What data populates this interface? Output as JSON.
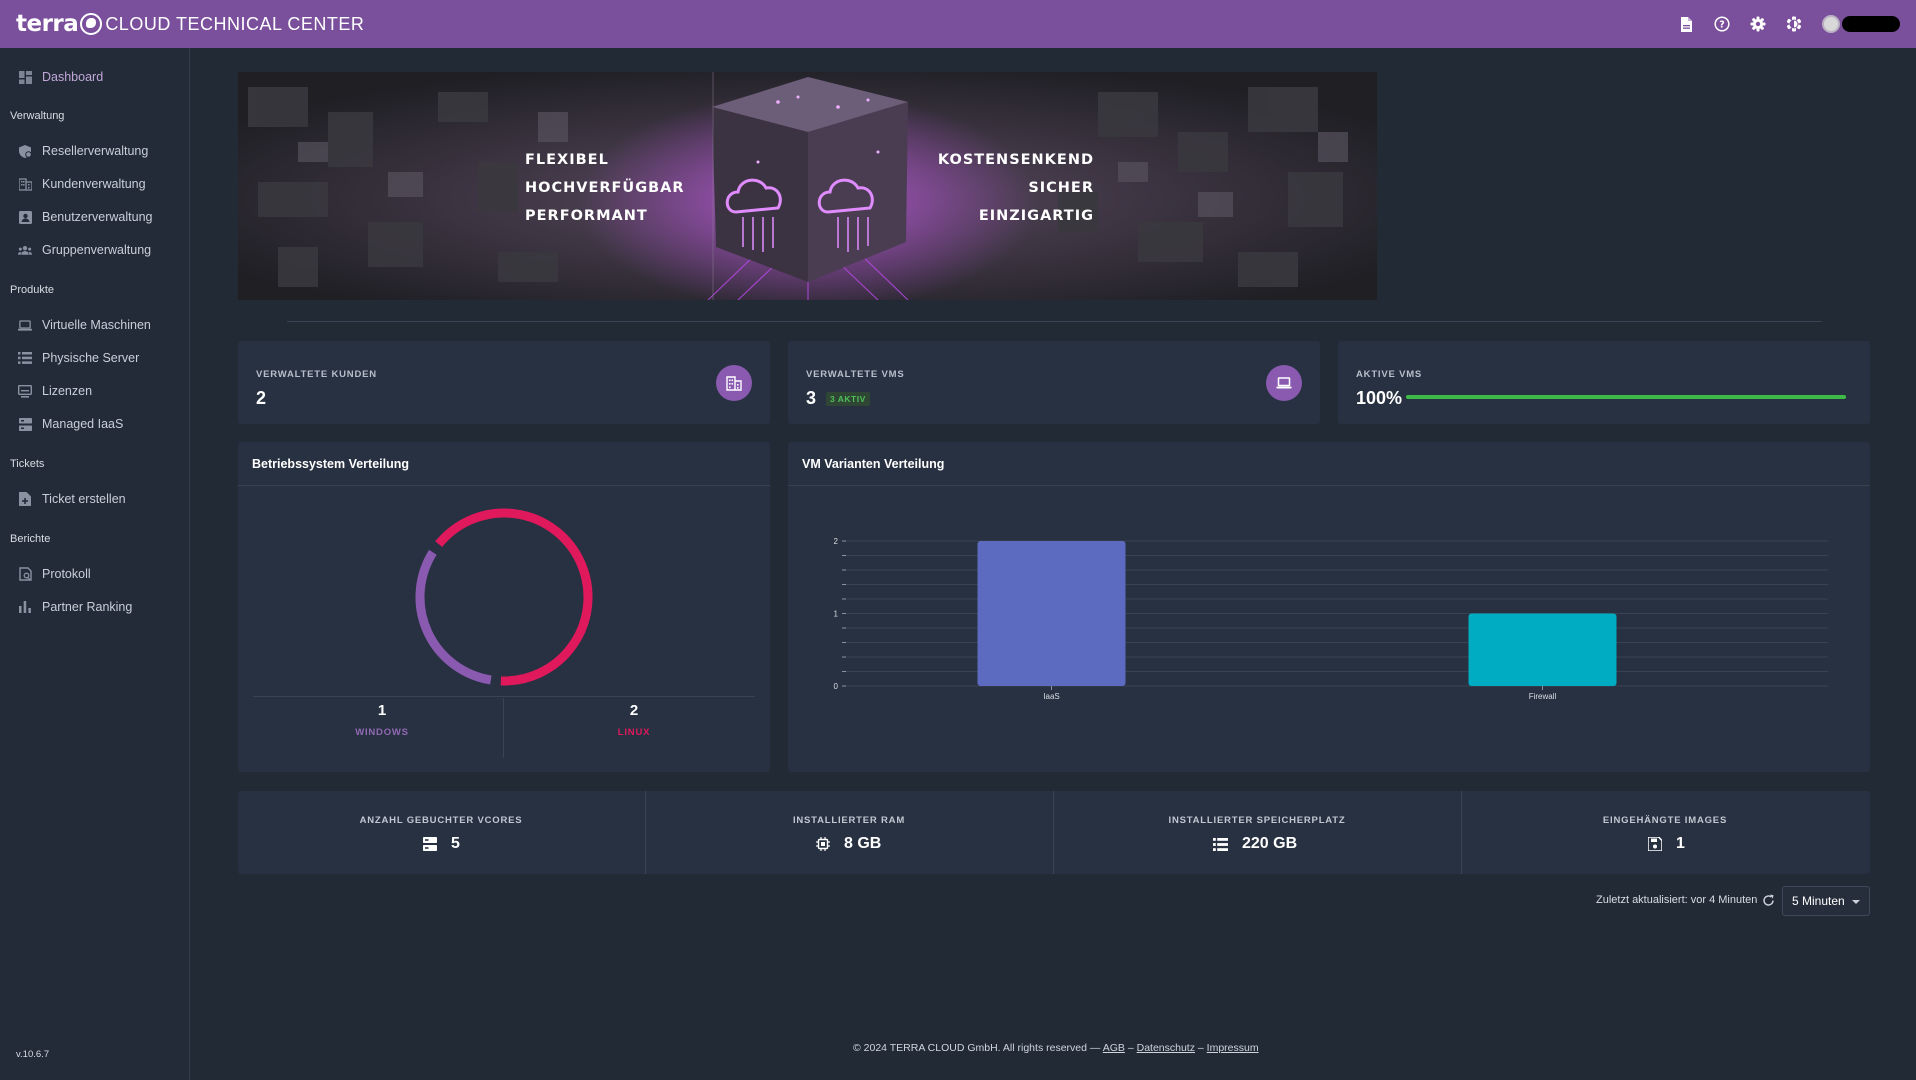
{
  "header": {
    "logo_text": "terra",
    "title": "CLOUD TECHNICAL CENTER",
    "icons": [
      "document-icon",
      "help-icon",
      "settings-icon",
      "theme-toggle-icon",
      "user-avatar"
    ]
  },
  "sidebar": {
    "dashboard": "Dashboard",
    "sections": {
      "verwaltung": "Verwaltung",
      "produkte": "Produkte",
      "tickets": "Tickets",
      "berichte": "Berichte"
    },
    "items": {
      "reseller": "Resellerverwaltung",
      "kunden": "Kundenverwaltung",
      "benutzer": "Benutzerverwaltung",
      "gruppen": "Gruppenverwaltung",
      "vms": "Virtuelle Maschinen",
      "server": "Physische Server",
      "lizenzen": "Lizenzen",
      "iaas": "Managed IaaS",
      "ticket": "Ticket erstellen",
      "protokoll": "Protokoll",
      "ranking": "Partner Ranking"
    },
    "version": "v.10.6.7"
  },
  "banner": {
    "left_words": [
      "FLEXIBEL",
      "HOCHVERFÜGBAR",
      "PERFORMANT"
    ],
    "right_words": [
      "KOSTENSENKEND",
      "SICHER",
      "EINZIGARTIG"
    ]
  },
  "kpis": {
    "kunden": {
      "label": "VERWALTETE KUNDEN",
      "value": "2"
    },
    "vms": {
      "label": "VERWALTETE VMS",
      "value": "3",
      "badge": "3 AKTIV"
    },
    "aktive": {
      "label": "AKTIVE VMS",
      "value": "100%",
      "progress": 1.0
    }
  },
  "os_panel": {
    "title": "Betriebssystem Verteilung",
    "windows": {
      "count": "1",
      "label": "WINDOWS",
      "color": "#8a5ab0"
    },
    "linux": {
      "count": "2",
      "label": "LINUX",
      "color": "#e0195c"
    }
  },
  "vm_panel": {
    "title": "VM Varianten Verteilung"
  },
  "chart_data": {
    "type": "bar",
    "categories": [
      "IaaS",
      "Firewall"
    ],
    "values": [
      2,
      1
    ],
    "colors": [
      "#5c6bc0",
      "#00acc1"
    ],
    "ylim": [
      0,
      2
    ],
    "yticks": [
      0,
      1,
      2
    ],
    "title": "VM Varianten Verteilung",
    "grid": true
  },
  "stats": [
    {
      "label": "ANZAHL GEBUCHTER VCORES",
      "value": "5",
      "icon": "server-icon"
    },
    {
      "label": "INSTALLIERTER RAM",
      "value": "8 GB",
      "icon": "memory-icon"
    },
    {
      "label": "INSTALLIERTER SPEICHERPLATZ",
      "value": "220 GB",
      "icon": "storage-icon"
    },
    {
      "label": "EINGEHÄNGTE IMAGES",
      "value": "1",
      "icon": "disk-image-icon"
    }
  ],
  "refresh": {
    "text": "Zuletzt aktualisiert: vor 4 Minuten",
    "interval": "5 Minuten"
  },
  "footer": {
    "copyright": "© 2024 TERRA CLOUD GmbH. All rights reserved —",
    "agb": "AGB",
    "datenschutz": "Datenschutz",
    "impressum": "Impressum",
    "sep": "–"
  }
}
